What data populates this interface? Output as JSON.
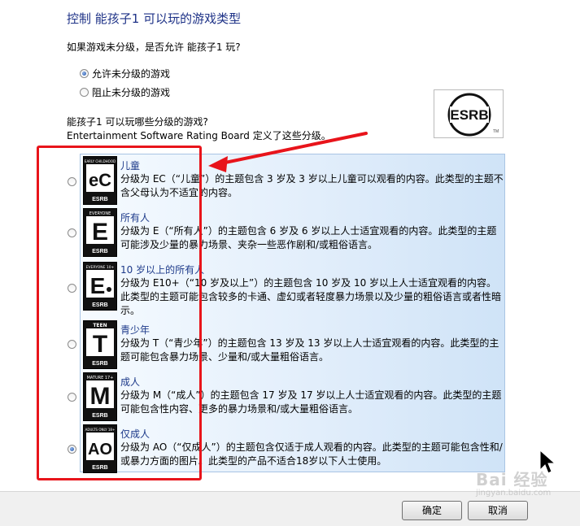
{
  "title": "控制 能孩子1 可以玩的游戏类型",
  "unrated": {
    "question": "如果游戏未分级，是否允许 能孩子1 玩?",
    "options": [
      {
        "label": "允许未分级的游戏",
        "checked": true
      },
      {
        "label": "阻止未分级的游戏",
        "checked": false
      }
    ]
  },
  "ratings_question": {
    "line1": "能孩子1 可以玩哪些分级的游戏?",
    "line2": "Entertainment Software Rating Board 定义了这些分级。"
  },
  "esrb_logo_text": "ESRB",
  "ratings": [
    {
      "name": "儿童",
      "badge_top": "EARLY CHILDHOOD",
      "badge_letter": "eC",
      "badge_bottom": "ESRB",
      "desc": "分级为 EC（“儿童”）的主题包含 3 岁及 3 岁以上儿童可以观看的内容。此类型的主题不含父母认为不适宜的内容。",
      "checked": false
    },
    {
      "name": "所有人",
      "badge_top": "EVERYONE",
      "badge_letter": "E",
      "badge_bottom": "ESRB",
      "desc": "分级为 E（“所有人”）的主题包含 6 岁及 6 岁以上人士适宜观看的内容。此类型的主题可能涉及少量的暴力场景、夹杂一些恶作剧和/或粗俗语言。",
      "checked": false
    },
    {
      "name": "10 岁以上的所有人",
      "badge_top": "EVERYONE 10+",
      "badge_letter": "E",
      "badge_bottom": "ESRB",
      "desc": "分级为 E10+（“10 岁及以上”）的主题包含 10 岁及 10 岁以上人士适宜观看的内容。此类型的主题可能包含较多的卡通、虚幻或者轻度暴力场景以及少量的粗俗语言或者性暗示。",
      "checked": false
    },
    {
      "name": "青少年",
      "badge_top": "TEEN",
      "badge_letter": "T",
      "badge_bottom": "ESRB",
      "desc": "分级为 T（“青少年”）的主题包含 13 岁及 13 岁以上人士适宜观看的内容。此类型的主题可能包含暴力场景、少量和/或大量粗俗语言。",
      "checked": false
    },
    {
      "name": "成人",
      "badge_top": "MATURE 17+",
      "badge_letter": "M",
      "badge_bottom": "ESRB",
      "desc": "分级为 M（“成人”）的主题包含 17 岁及 17 岁以上人士适宜观看的内容。此类型的主题可能包含性内容、更多的暴力场景和/或大量粗俗语言。",
      "checked": false
    },
    {
      "name": "仅成人",
      "badge_top": "ADULTS ONLY 18+",
      "badge_letter": "AO",
      "badge_bottom": "ESRB",
      "desc": "分级为 AO（“仅成人”）的主题包含仅适于成人观看的内容。此类型的主题可能包含性和/或暴力方面的图片。此类型的产品不适合18岁以下人士使用。",
      "checked": true
    }
  ],
  "buttons": {
    "ok": "确定",
    "cancel": "取消"
  },
  "watermark": {
    "main": "Bai 经验",
    "sub": "jingyan.baidu.com"
  },
  "colors": {
    "highlight_outline": "#e8141b",
    "panel_border": "#a9c4e4",
    "title": "#1e3287"
  }
}
